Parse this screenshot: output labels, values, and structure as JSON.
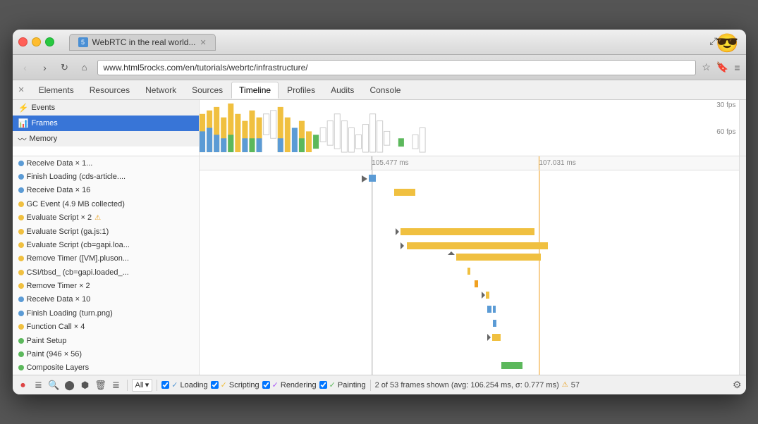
{
  "browser": {
    "tab_title": "WebRTC in the real world...",
    "url": "www.html5rocks.com/en/tutorials/webrtc/infrastructure/",
    "url_protocol": "http://",
    "emoji": "😎"
  },
  "devtools": {
    "tabs": [
      "Elements",
      "Resources",
      "Network",
      "Sources",
      "Timeline",
      "Profiles",
      "Audits",
      "Console"
    ],
    "active_tab": "Timeline",
    "fps_labels": {
      "top": "30 fps",
      "middle": "60 fps"
    }
  },
  "timeline": {
    "sidebar_sections": [
      {
        "id": "events",
        "label": "Events",
        "type": "header"
      },
      {
        "id": "frames",
        "label": "Frames",
        "type": "header-selected"
      },
      {
        "id": "memory",
        "label": "Memory",
        "type": "header"
      }
    ],
    "ruler_marks": [
      {
        "label": "105.477 ms",
        "pos": "35%"
      },
      {
        "label": "107.031 ms",
        "pos": "67%"
      }
    ],
    "events": [
      {
        "label": "Receive Data × 1...",
        "color": "blue",
        "indent": 0
      },
      {
        "label": "Finish Loading (cds-article....",
        "color": "blue",
        "indent": 0
      },
      {
        "label": "Receive Data × 16",
        "color": "blue",
        "indent": 0
      },
      {
        "label": "GC Event (4.9 MB collected)",
        "color": "yellow",
        "indent": 0
      },
      {
        "label": "Evaluate Script × 2",
        "color": "yellow",
        "has_warning": true,
        "indent": 0
      },
      {
        "label": "Evaluate Script (ga.js:1)",
        "color": "yellow",
        "indent": 0
      },
      {
        "label": "Evaluate Script (cb=gapi.loa...",
        "color": "yellow",
        "indent": 0
      },
      {
        "label": "Remove Timer ([VM].pluson...",
        "color": "yellow",
        "indent": 0
      },
      {
        "label": "CSI/tbsd_ (cb=gapi.loaded_...",
        "color": "yellow",
        "indent": 0
      },
      {
        "label": "Remove Timer × 2",
        "color": "yellow",
        "indent": 0
      },
      {
        "label": "Receive Data × 10",
        "color": "blue",
        "indent": 0
      },
      {
        "label": "Finish Loading (turn.png)",
        "color": "blue",
        "indent": 0
      },
      {
        "label": "Function Call × 4",
        "color": "yellow",
        "indent": 0
      },
      {
        "label": "Paint Setup",
        "color": "green",
        "indent": 0
      },
      {
        "label": "Paint (946 × 56)",
        "color": "green",
        "indent": 0
      },
      {
        "label": "Composite Layers",
        "color": "green",
        "indent": 0
      }
    ]
  },
  "toolbar": {
    "filter_label": "All",
    "checkboxes": [
      {
        "label": "Loading",
        "checked": true,
        "color": "#5b9bd5"
      },
      {
        "label": "Scripting",
        "checked": true,
        "color": "#f0c040"
      },
      {
        "label": "Rendering",
        "checked": true,
        "color": "#a855f7"
      },
      {
        "label": "Painting",
        "checked": true,
        "color": "#5cb85c"
      }
    ],
    "status": "2 of 53 frames shown (avg: 106.254 ms, σ: 0.777 ms)",
    "warning": "⚠",
    "frame_count": "57"
  }
}
